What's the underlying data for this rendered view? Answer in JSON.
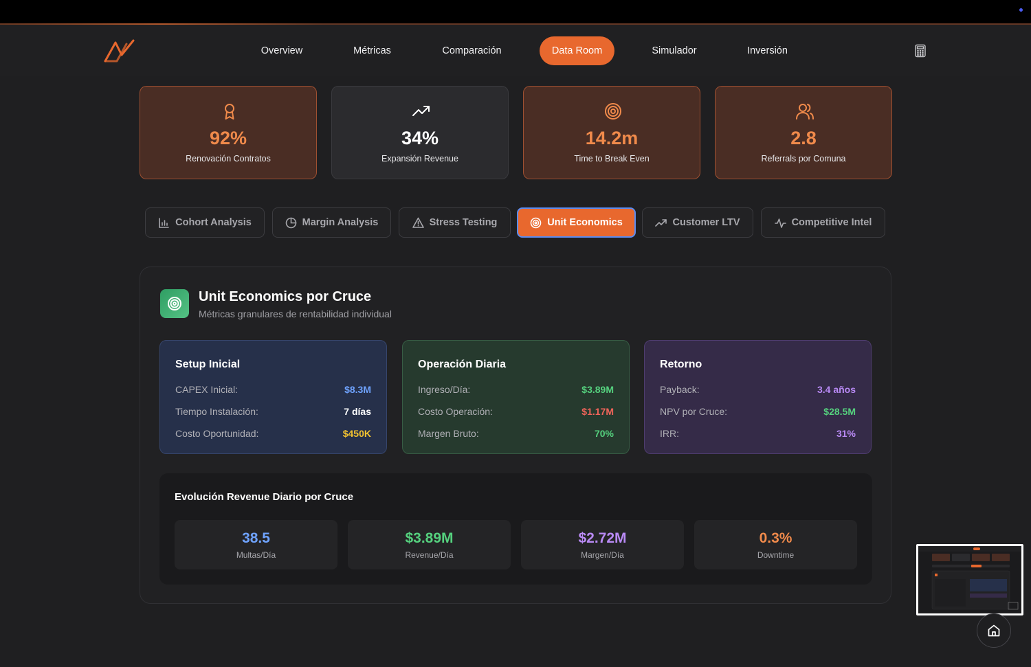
{
  "nav": {
    "items": [
      {
        "label": "Overview",
        "active": false
      },
      {
        "label": "Métricas",
        "active": false
      },
      {
        "label": "Comparación",
        "active": false
      },
      {
        "label": "Data Room",
        "active": true
      },
      {
        "label": "Simulador",
        "active": false
      },
      {
        "label": "Inversión",
        "active": false
      }
    ],
    "accent": "#e8682e"
  },
  "stats": [
    {
      "icon": "award-icon",
      "value": "92%",
      "label": "Renovación Contratos"
    },
    {
      "icon": "trending-up-icon",
      "value": "34%",
      "label": "Expansión Revenue"
    },
    {
      "icon": "target-icon",
      "value": "14.2m",
      "label": "Time to Break Even"
    },
    {
      "icon": "users-icon",
      "value": "2.8",
      "label": "Referrals por Comuna"
    }
  ],
  "tabs": [
    {
      "icon": "bar-chart-icon",
      "label": "Cohort Analysis"
    },
    {
      "icon": "pie-chart-icon",
      "label": "Margin Analysis"
    },
    {
      "icon": "warning-icon",
      "label": "Stress Testing"
    },
    {
      "icon": "target-icon",
      "label": "Unit Economics",
      "active": true
    },
    {
      "icon": "trending-up-icon",
      "label": "Customer LTV"
    },
    {
      "icon": "activity-icon",
      "label": "Competitive Intel"
    }
  ],
  "panel": {
    "title": "Unit Economics por Cruce",
    "subtitle": "Métricas granulares de rentabilidad individual",
    "cards": {
      "setup": {
        "title": "Setup Inicial",
        "rows": [
          {
            "key": "CAPEX Inicial:",
            "value": "$8.3M",
            "color": "#6fa3ff"
          },
          {
            "key": "Tiempo Instalación:",
            "value": "7 días",
            "color": "#ffffff"
          },
          {
            "key": "Costo Oportunidad:",
            "value": "$450K",
            "color": "#f2c230"
          }
        ]
      },
      "operacion": {
        "title": "Operación Diaria",
        "rows": [
          {
            "key": "Ingreso/Día:",
            "value": "$3.89M",
            "color": "#55d17e"
          },
          {
            "key": "Costo Operación:",
            "value": "$1.17M",
            "color": "#f0645a"
          },
          {
            "key": "Margen Bruto:",
            "value": "70%",
            "color": "#55d17e"
          }
        ]
      },
      "retorno": {
        "title": "Retorno",
        "rows": [
          {
            "key": "Payback:",
            "value": "3.4 años",
            "color": "#b98af5"
          },
          {
            "key": "NPV por Cruce:",
            "value": "$28.5M",
            "color": "#55d17e"
          },
          {
            "key": "IRR:",
            "value": "31%",
            "color": "#b98af5"
          }
        ]
      }
    },
    "evolution": {
      "title": "Evolución Revenue Diario por Cruce",
      "items": [
        {
          "value": "38.5",
          "label": "Multas/Día",
          "color": "#6fa3ff"
        },
        {
          "value": "$3.89M",
          "label": "Revenue/Día",
          "color": "#55d17e"
        },
        {
          "value": "$2.72M",
          "label": "Margen/Día",
          "color": "#b98af5"
        },
        {
          "value": "0.3%",
          "label": "Downtime",
          "color": "#f08a4b"
        }
      ]
    }
  }
}
